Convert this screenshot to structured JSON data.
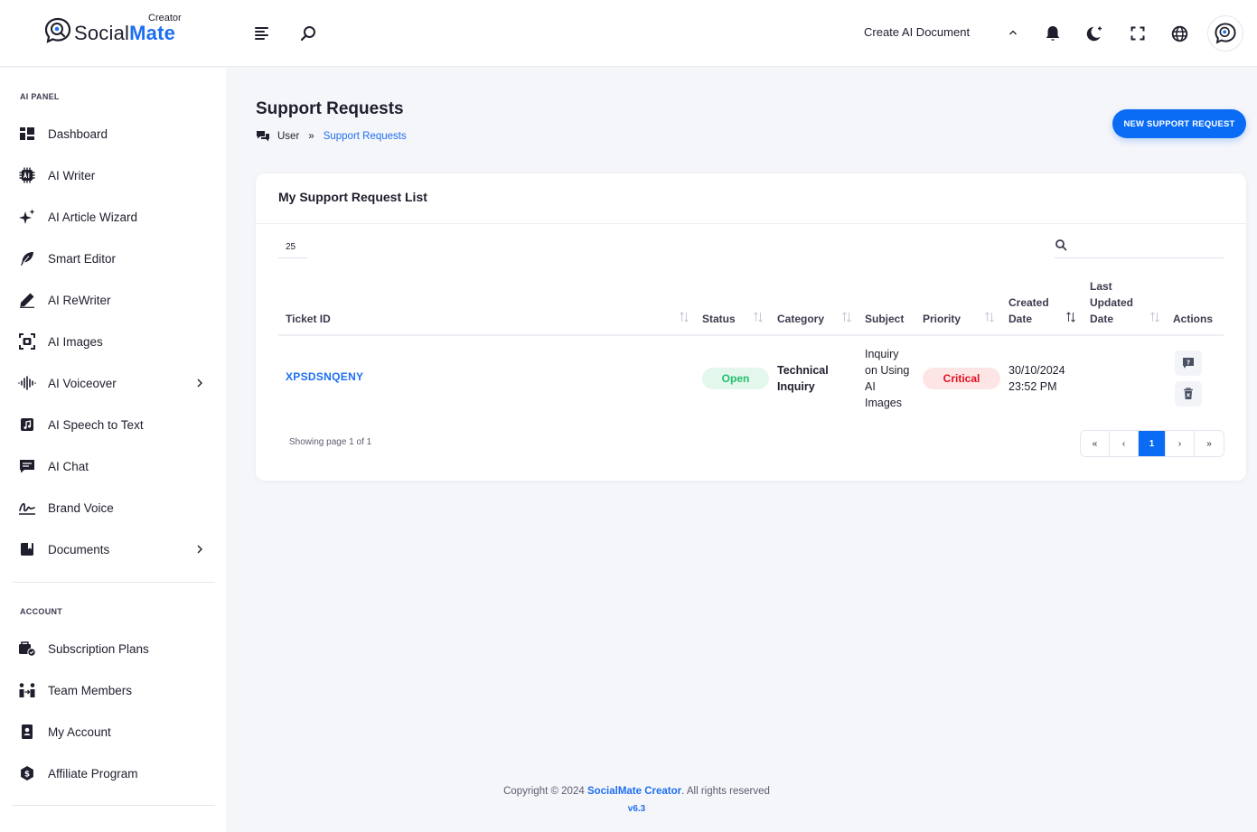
{
  "header": {
    "logo_creator": "Creator",
    "logo_social": "Social",
    "logo_mate": "Mate",
    "create_label": "Create AI Document",
    "icons": [
      "menu-icon",
      "search-icon",
      "chevron-up-icon",
      "bell-icon",
      "moon-icon",
      "fullscreen-icon",
      "globe-icon"
    ]
  },
  "sidebar": {
    "section_ai": "AI PANEL",
    "section_account": "ACCOUNT",
    "items": [
      {
        "label": "Dashboard",
        "icon": "dashboard-icon"
      },
      {
        "label": "AI Writer",
        "icon": "ai-chip-icon"
      },
      {
        "label": "AI Article Wizard",
        "icon": "sparkles-icon"
      },
      {
        "label": "Smart Editor",
        "icon": "feather-icon"
      },
      {
        "label": "AI ReWriter",
        "icon": "pen-icon"
      },
      {
        "label": "AI Images",
        "icon": "image-scan-icon"
      },
      {
        "label": "AI Voiceover",
        "icon": "waveform-icon"
      },
      {
        "label": "AI Speech to Text",
        "icon": "music-note-icon"
      },
      {
        "label": "AI Chat",
        "icon": "chat-icon"
      },
      {
        "label": "Brand Voice",
        "icon": "signature-icon"
      },
      {
        "label": "Documents",
        "icon": "folder-icon"
      }
    ],
    "account_items": [
      {
        "label": "Subscription Plans",
        "icon": "subscription-icon"
      },
      {
        "label": "Team Members",
        "icon": "team-icon"
      },
      {
        "label": "My Account",
        "icon": "account-card-icon"
      },
      {
        "label": "Affiliate Program",
        "icon": "dollar-coin-icon"
      }
    ]
  },
  "page": {
    "title": "Support Requests",
    "breadcrumb_user": "User",
    "breadcrumb_sep": "»",
    "breadcrumb_current": "Support Requests",
    "new_button": "NEW SUPPORT REQUEST"
  },
  "card": {
    "title": "My Support Request List",
    "page_length": "25",
    "search_value": "",
    "columns": [
      "Ticket ID",
      "Status",
      "Category",
      "Subject",
      "Priority",
      "Created Date",
      "Last Updated Date",
      "Actions"
    ],
    "col_created_1": "Created",
    "col_created_2": "Date",
    "col_updated_1": "Last",
    "col_updated_2": "Updated",
    "col_updated_3": "Date",
    "rows": [
      {
        "ticket_id": "XPSDSNQENY",
        "status": "Open",
        "category_1": "Technical",
        "category_2": "Inquiry",
        "subject_1": "Inquiry",
        "subject_2": "on Using",
        "subject_3": "AI",
        "subject_4": "Images",
        "priority": "Critical",
        "created_1": "30/10/2024",
        "created_2": "23:52 PM",
        "updated": ""
      }
    ],
    "showing": "Showing page 1 of 1",
    "pager": {
      "first": "«",
      "prev": "‹",
      "current": "1",
      "next": "›",
      "last": "»"
    }
  },
  "footer": {
    "prefix": "Copyright © 2024 ",
    "brand": "SocialMate Creator",
    "suffix": ". All rights reserved",
    "version": "v6.3"
  },
  "colors": {
    "accent": "#0a6cf5",
    "open": "#1fbf6b",
    "critical": "#e3101e"
  }
}
